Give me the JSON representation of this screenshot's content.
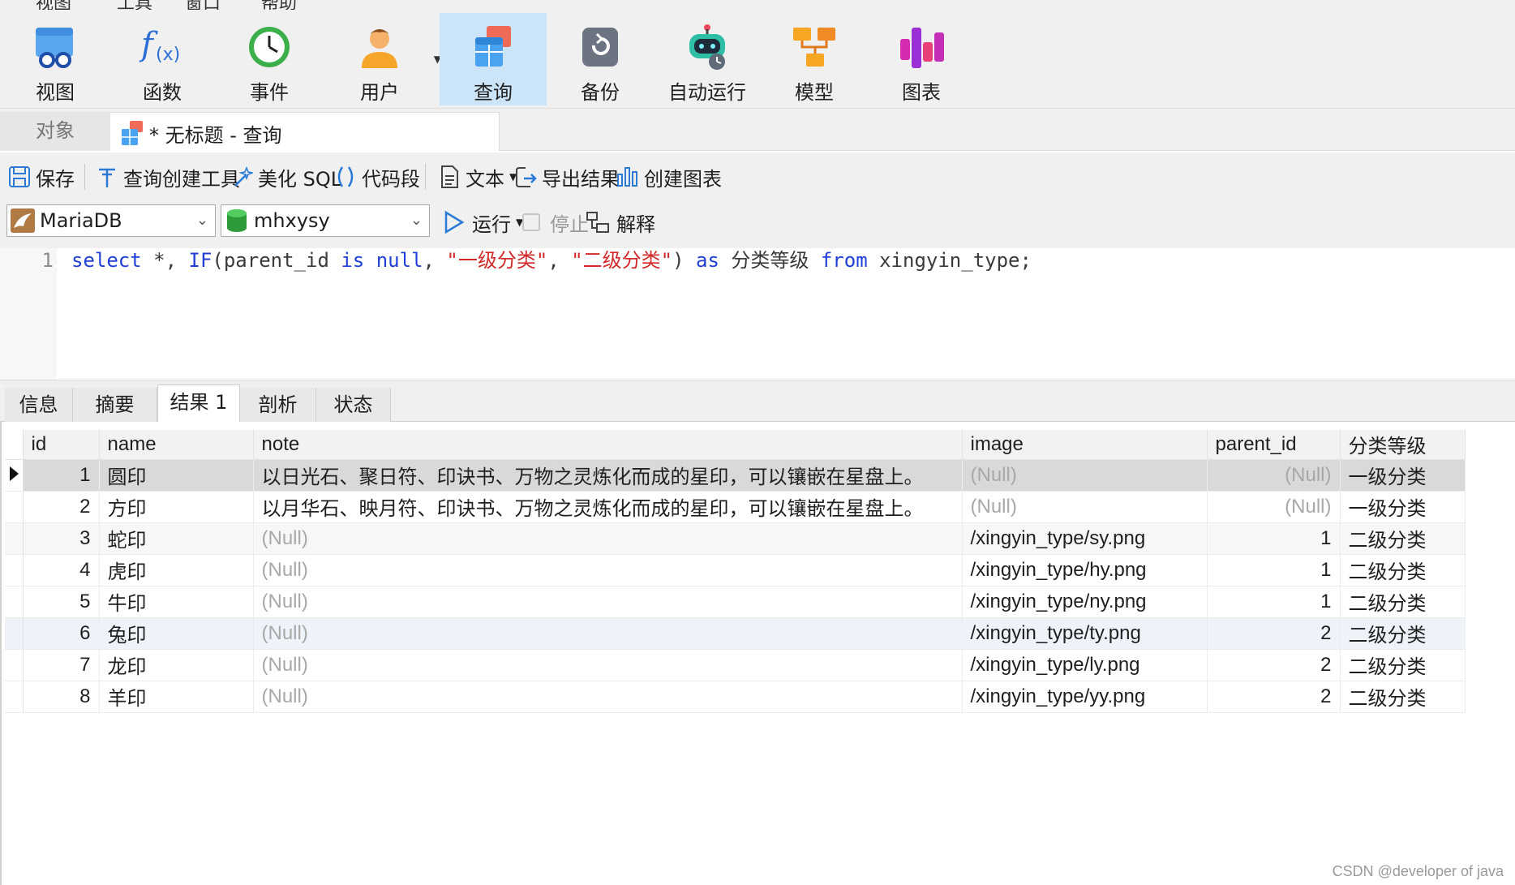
{
  "menu": [
    "视图",
    "工具",
    "窗口",
    "帮助"
  ],
  "ribbon": {
    "buttons": [
      {
        "label": "视图",
        "icon": "view-icon"
      },
      {
        "label": "函数",
        "icon": "function-icon"
      },
      {
        "label": "事件",
        "icon": "event-clock-icon"
      },
      {
        "label": "用户",
        "icon": "user-icon"
      },
      {
        "label": "查询",
        "icon": "query-icon"
      },
      {
        "label": "备份",
        "icon": "backup-icon"
      },
      {
        "label": "自动运行",
        "icon": "robot-icon"
      },
      {
        "label": "模型",
        "icon": "model-icon"
      },
      {
        "label": "图表",
        "icon": "chart-icon"
      }
    ],
    "active": "查询"
  },
  "tabs": {
    "objects": "对象",
    "query": "* 无标题 - 查询"
  },
  "toolbar": {
    "save": "保存",
    "query_builder": "查询创建工具",
    "beautify": "美化 SQL",
    "snippet": "代码段",
    "text": "文本",
    "export": "导出结果",
    "create_chart": "创建图表"
  },
  "connection": {
    "server": "MariaDB",
    "database": "mhxysy",
    "run": "运行",
    "stop": "停止",
    "explain": "解释"
  },
  "editor": {
    "line_number": "1",
    "tokens": {
      "select": "select",
      "star": " *, ",
      "if": "IF",
      "open": "(parent_id ",
      "is": "is",
      "null": "null",
      "comma1": ", ",
      "str1": "\"一级分类\"",
      "comma2": ", ",
      "str2": "\"二级分类\"",
      "close": ") ",
      "as": "as",
      "alias": " 分类等级 ",
      "from": "from",
      "table": " xingyin_type;"
    }
  },
  "result_tabs": [
    "信息",
    "摘要",
    "结果 1",
    "剖析",
    "状态"
  ],
  "active_result_tab": "结果 1",
  "grid": {
    "columns": [
      "id",
      "name",
      "note",
      "image",
      "parent_id",
      "分类等级"
    ],
    "rows": [
      {
        "id": "1",
        "name": "圆印",
        "note": "以日光石、聚日符、印诀书、万物之灵炼化而成的星印，可以镶嵌在星盘上。",
        "image": "(Null)",
        "parent_id": "(Null)",
        "level": "一级分类"
      },
      {
        "id": "2",
        "name": "方印",
        "note": "以月华石、映月符、印诀书、万物之灵炼化而成的星印，可以镶嵌在星盘上。",
        "image": "(Null)",
        "parent_id": "(Null)",
        "level": "一级分类"
      },
      {
        "id": "3",
        "name": "蛇印",
        "note": "(Null)",
        "image": "/xingyin_type/sy.png",
        "parent_id": "1",
        "level": "二级分类"
      },
      {
        "id": "4",
        "name": "虎印",
        "note": "(Null)",
        "image": "/xingyin_type/hy.png",
        "parent_id": "1",
        "level": "二级分类"
      },
      {
        "id": "5",
        "name": "牛印",
        "note": "(Null)",
        "image": "/xingyin_type/ny.png",
        "parent_id": "1",
        "level": "二级分类"
      },
      {
        "id": "6",
        "name": "兔印",
        "note": "(Null)",
        "image": "/xingyin_type/ty.png",
        "parent_id": "2",
        "level": "二级分类"
      },
      {
        "id": "7",
        "name": "龙印",
        "note": "(Null)",
        "image": "/xingyin_type/ly.png",
        "parent_id": "2",
        "level": "二级分类"
      },
      {
        "id": "8",
        "name": "羊印",
        "note": "(Null)",
        "image": "/xingyin_type/yy.png",
        "parent_id": "2",
        "level": "二级分类"
      }
    ]
  },
  "watermark": "CSDN @developer of java"
}
